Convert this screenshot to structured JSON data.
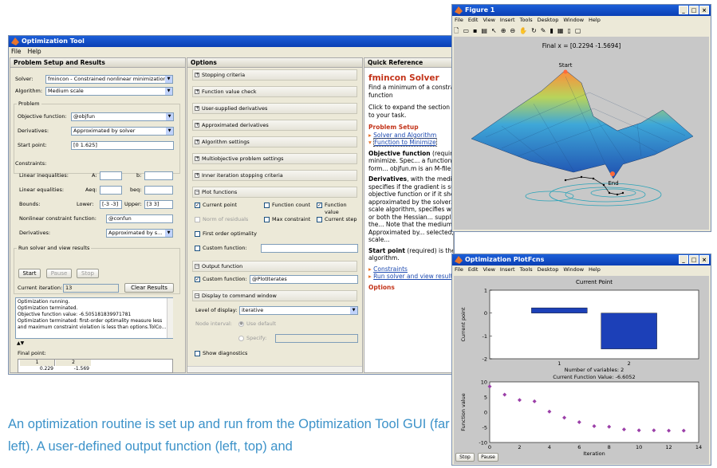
{
  "optim_tool": {
    "title": "Optimization Tool",
    "menu": [
      "File",
      "Help"
    ],
    "panel_problem": "Problem Setup and Results",
    "panel_options": "Options",
    "panel_quickref": "Quick Reference",
    "solver_label": "Solver:",
    "solver_value": "fmincon - Constrained nonlinear minimization",
    "algorithm_label": "Algorithm:",
    "algorithm_value": "Medium scale",
    "problem_group": "Problem",
    "objective_label": "Objective function:",
    "objective_value": "@objfun",
    "derivatives_label": "Derivatives:",
    "derivatives_value": "Approximated by solver",
    "startpoint_label": "Start point:",
    "startpoint_value": "[0 1.625]",
    "constraints_group": "Constraints:",
    "lin_ineq_label": "Linear inequalities:",
    "A_label": "A:",
    "b_label": "b:",
    "lin_eq_label": "Linear equalities:",
    "Aeq_label": "Aeq:",
    "beq_label": "beq:",
    "bounds_label": "Bounds:",
    "lower_label": "Lower:",
    "lower_value": "[-3 -3]",
    "upper_label": "Upper:",
    "upper_value": "[3 3]",
    "nonlcon_label": "Nonlinear constraint function:",
    "nonlcon_value": "@confun",
    "derivatives2_label": "Derivatives:",
    "derivatives2_value": "Approximated by s...",
    "run_group": "Run solver and view results",
    "start_button": "Start",
    "pause_button": "Pause",
    "stop_button": "Stop",
    "current_iteration_label": "Current iteration:",
    "current_iteration_value": "13",
    "clear_results_button": "Clear Results",
    "status_lines": [
      "Optimization running.",
      "Optimization terminated.",
      "Objective function value: -6.505181839971781",
      "Optimization terminated: first-order optimality measure less",
      "and maximum constraint violation is less than options.TolCo..."
    ],
    "final_point_label": "Final point:",
    "final_point_headers": [
      "1",
      "2"
    ],
    "final_point_values": [
      "0.229",
      "-1.569"
    ]
  },
  "options": {
    "sections": [
      "Stopping criteria",
      "Function value check",
      "User-supplied derivatives",
      "Approximated derivatives",
      "Algorithm settings",
      "Multiobjective problem settings",
      "Inner iteration stopping criteria",
      "Plot functions"
    ],
    "plot_current_point": "Current point",
    "plot_function_count": "Function count",
    "plot_function_value": "Function value",
    "plot_norm_residuals": "Norm of residuals",
    "plot_max_constraint": "Max constraint",
    "plot_current_step": "Current step",
    "plot_first_order": "First order optimality",
    "plot_custom": "Custom function:",
    "output_section": "Output function",
    "output_custom": "Custom function:",
    "output_custom_value": "@PlotIterates",
    "display_section": "Display to command window",
    "level_label": "Level of display:",
    "level_value": "iterative",
    "node_interval_label": "Node interval:",
    "use_default": "Use default",
    "specify": "Specify:",
    "show_diagnostics": "Show diagnostics"
  },
  "quickref": {
    "heading": "fmincon Solver",
    "intro": "Find a minimum of a constra... multivariable function",
    "click_text": "Click to expand the section b... corresponding to your task.",
    "problem_setup": "Problem Setup",
    "link_solver": "Solver and Algorithm",
    "link_function": "Function to Minimize",
    "objective_bold": "Objective function",
    "objective_text": " (require... you want to minimize. Spec... a function handle of the form... objfun.m is an M-file or as... function.",
    "derivatives_bold": "Derivatives",
    "derivatives_text": ", with the mediu... algorithm, specifies if the gradient is supplied in the objective function or if it should be approximated by the solver. With the large-scale algorithm, specifies whether the gradient or both the Hessian... supplied by the user in the... Note that the medium-scale... when Approximated by... selected, even if large scale...",
    "start_bold": "Start point",
    "start_text": " (required) is the... (vector) for the algorithm.",
    "link_constraints": "Constraints",
    "link_run": "Run solver and view result...",
    "options_heading": "Options"
  },
  "figure1": {
    "title": "Figure 1",
    "menu": [
      "File",
      "Edit",
      "View",
      "Insert",
      "Tools",
      "Desktop",
      "Window",
      "Help"
    ],
    "plot_title": "Final x = [0.2294 -1.5694]",
    "label_start": "Start",
    "label_end": "End"
  },
  "plotfcns": {
    "title": "Optimization PlotFcns",
    "menu": [
      "File",
      "Edit",
      "View",
      "Insert",
      "Tools",
      "Desktop",
      "Window",
      "Help"
    ],
    "stop_button": "Stop",
    "pause_button": "Pause"
  },
  "chart_data": [
    {
      "type": "bar",
      "title": "Current Point",
      "xlabel": "Number of variables: 2",
      "ylabel": "Current point",
      "categories": [
        "1",
        "2"
      ],
      "values": [
        0.229,
        -1.569
      ],
      "ylim": [
        -2,
        1
      ],
      "yticks": [
        -2,
        -1,
        0,
        1
      ],
      "color": "#1c40b8"
    },
    {
      "type": "scatter",
      "title": "Current Function Value: -6.6052",
      "xlabel": "Iteration",
      "ylabel": "Function value",
      "x": [
        0,
        1,
        2,
        3,
        4,
        5,
        6,
        7,
        8,
        9,
        10,
        11,
        12,
        13
      ],
      "y": [
        8.5,
        5.8,
        4.0,
        3.6,
        0.2,
        -1.8,
        -3.3,
        -4.6,
        -4.8,
        -5.7,
        -6.0,
        -6.0,
        -6.1,
        -6.1
      ],
      "xlim": [
        0,
        14
      ],
      "ylim": [
        -10,
        10
      ],
      "xticks": [
        0,
        2,
        4,
        6,
        8,
        10,
        12,
        14
      ],
      "yticks": [
        -10,
        -5,
        0,
        5,
        10
      ],
      "color": "#9b3fa8"
    }
  ],
  "caption": "An optimization routine is set up and run from the Optimization Tool GUI (far left). A user-defined output function (left, top) and"
}
